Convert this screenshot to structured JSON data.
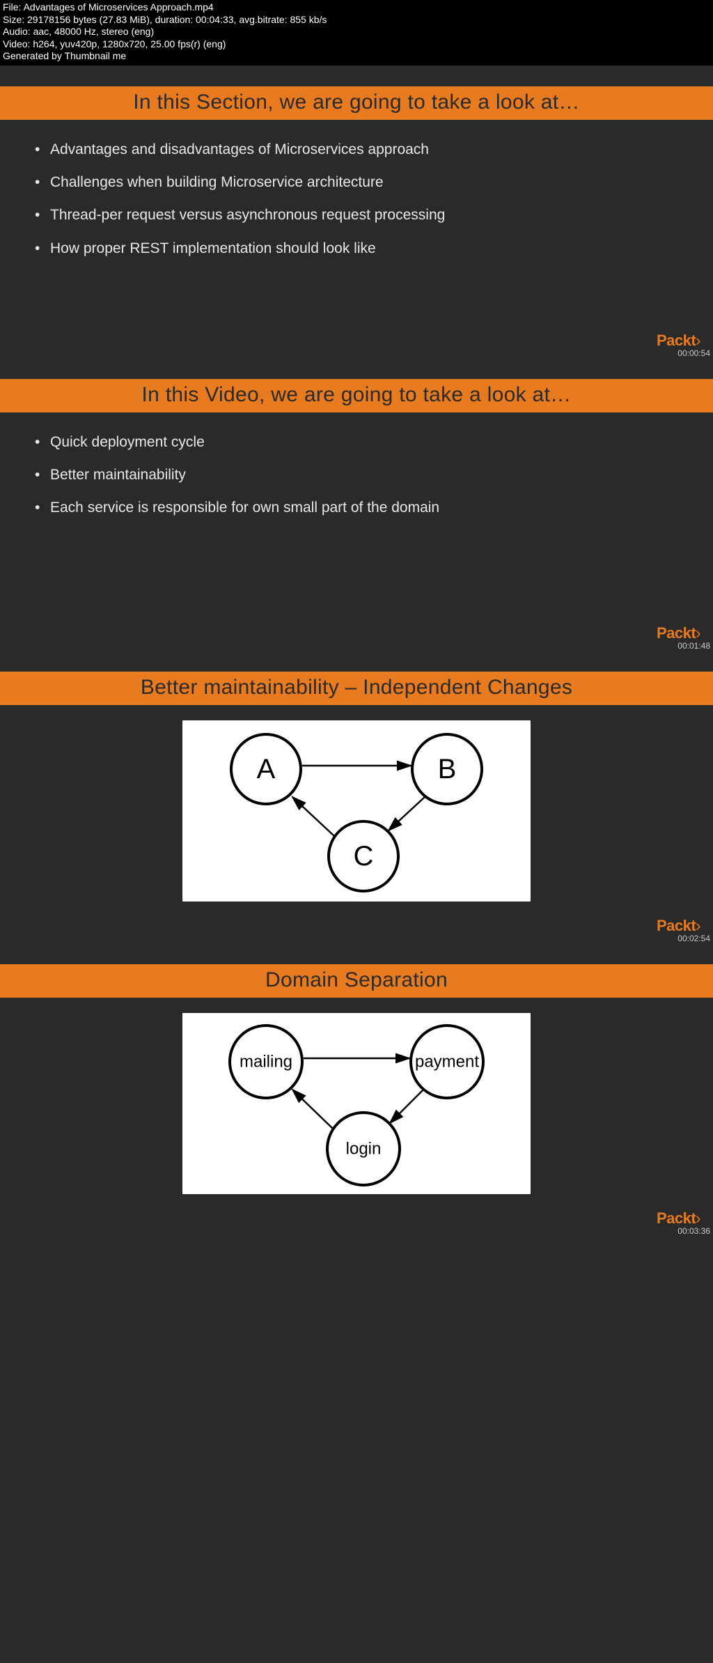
{
  "meta": {
    "file": "File: Advantages of Microservices Approach.mp4",
    "size": "Size: 29178156 bytes (27.83 MiB), duration: 00:04:33, avg.bitrate: 855 kb/s",
    "audio": "Audio: aac, 48000 Hz, stereo (eng)",
    "video": "Video: h264, yuv420p, 1280x720, 25.00 fps(r) (eng)",
    "generated": "Generated by Thumbnail me"
  },
  "logo_text": "Packt",
  "logo_angle": "›",
  "slides": [
    {
      "title": "In this Section, we are going to take a look at…",
      "bullets": [
        "Advantages and disadvantages of Microservices approach",
        "Challenges when building Microservice architecture",
        "Thread-per request versus asynchronous request processing",
        "How proper REST implementation should look like"
      ],
      "timestamp": "00:00:54"
    },
    {
      "title": "In this Video, we are going to take a look at…",
      "bullets": [
        "Quick deployment cycle",
        "Better maintainability",
        "Each service is responsible for own small part of the domain"
      ],
      "timestamp": "00:01:48"
    },
    {
      "title": "Better maintainability – Independent Changes",
      "diagram": {
        "nodes": [
          "A",
          "B",
          "C"
        ],
        "font_size": 40
      },
      "timestamp": "00:02:54"
    },
    {
      "title": "Domain Separation",
      "diagram": {
        "nodes": [
          "mailing",
          "payment",
          "login"
        ],
        "font_size": 24
      },
      "timestamp": "00:03:36"
    }
  ]
}
